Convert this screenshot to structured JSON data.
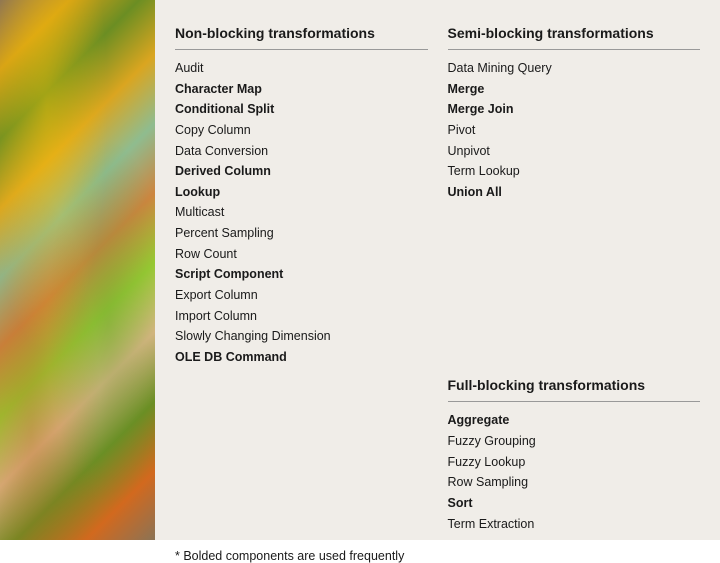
{
  "headings": {
    "non_blocking": "Non-blocking transformations",
    "semi_blocking": "Semi-blocking transformations",
    "full_blocking": "Full-blocking transformations"
  },
  "non_blocking_items": [
    {
      "label": "Audit",
      "bold": false
    },
    {
      "label": "Character Map",
      "bold": true
    },
    {
      "label": "Conditional Split",
      "bold": true
    },
    {
      "label": "Copy Column",
      "bold": false
    },
    {
      "label": "Data Conversion",
      "bold": false
    },
    {
      "label": "Derived Column",
      "bold": true
    },
    {
      "label": "Lookup",
      "bold": true
    },
    {
      "label": "Multicast",
      "bold": false
    },
    {
      "label": "Percent Sampling",
      "bold": false
    },
    {
      "label": "Row Count",
      "bold": false
    },
    {
      "label": "Script Component",
      "bold": true
    },
    {
      "label": "Export Column",
      "bold": false
    },
    {
      "label": "Import Column",
      "bold": false
    },
    {
      "label": "Slowly Changing Dimension",
      "bold": false
    },
    {
      "label": "OLE DB Command",
      "bold": true
    }
  ],
  "semi_blocking_items": [
    {
      "label": "Data Mining Query",
      "bold": false
    },
    {
      "label": "Merge",
      "bold": true
    },
    {
      "label": "Merge Join",
      "bold": true
    },
    {
      "label": "Pivot",
      "bold": false
    },
    {
      "label": "Unpivot",
      "bold": false
    },
    {
      "label": "Term Lookup",
      "bold": false
    },
    {
      "label": "Union All",
      "bold": true
    }
  ],
  "full_blocking_items": [
    {
      "label": "Aggregate",
      "bold": true
    },
    {
      "label": "Fuzzy Grouping",
      "bold": false
    },
    {
      "label": "Fuzzy Lookup",
      "bold": false
    },
    {
      "label": "Row Sampling",
      "bold": false
    },
    {
      "label": "Sort",
      "bold": true
    },
    {
      "label": "Term Extraction",
      "bold": false
    }
  ],
  "footer": "* Bolded components are used frequently"
}
